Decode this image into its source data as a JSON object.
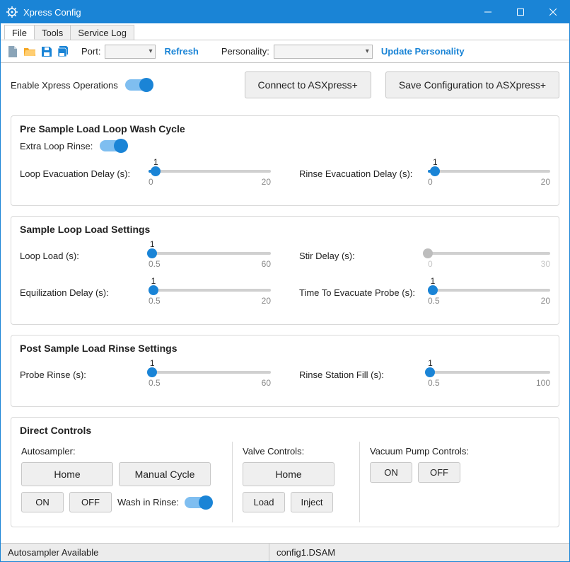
{
  "window": {
    "title": "Xpress Config"
  },
  "menu": {
    "file": "File",
    "tools": "Tools",
    "service_log": "Service Log"
  },
  "toolbar": {
    "port_label": "Port:",
    "refresh": "Refresh",
    "personality_label": "Personality:",
    "update_personality": "Update Personality"
  },
  "top": {
    "enable_label": "Enable Xpress Operations",
    "connect_btn": "Connect to ASXpress+",
    "save_btn": "Save Configuration to ASXpress+"
  },
  "sections": {
    "pre_wash": {
      "title": "Pre Sample Load Loop Wash Cycle",
      "extra_rinse_label": "Extra Loop Rinse:",
      "loop_evac": {
        "label": "Loop Evacuation Delay (s):",
        "value": "1",
        "min": "0",
        "max": "20"
      },
      "rinse_evac": {
        "label": "Rinse Evacuation Delay (s):",
        "value": "1",
        "min": "0",
        "max": "20"
      }
    },
    "loop_load": {
      "title": "Sample Loop Load Settings",
      "loop_load": {
        "label": "Loop Load (s):",
        "value": "1",
        "min": "0.5",
        "max": "60"
      },
      "stir_delay": {
        "label": "Stir Delay (s):",
        "value": "",
        "min": "0",
        "max": "30"
      },
      "equil": {
        "label": "Equilization Delay (s):",
        "value": "1",
        "min": "0.5",
        "max": "20"
      },
      "evac_probe": {
        "label": "Time To Evacuate Probe (s):",
        "value": "1",
        "min": "0.5",
        "max": "20"
      }
    },
    "post_rinse": {
      "title": "Post Sample Load Rinse Settings",
      "probe_rinse": {
        "label": "Probe Rinse (s):",
        "value": "1",
        "min": "0.5",
        "max": "60"
      },
      "station_fill": {
        "label": "Rinse Station Fill (s):",
        "value": "1",
        "min": "0.5",
        "max": "100"
      }
    },
    "direct": {
      "title": "Direct Controls",
      "autosampler_label": "Autosampler:",
      "valve_label": "Valve Controls:",
      "vacuum_label": "Vacuum Pump Controls:",
      "home": "Home",
      "manual_cycle": "Manual Cycle",
      "on": "ON",
      "off": "OFF",
      "wash_in_rinse": "Wash in Rinse:",
      "load": "Load",
      "inject": "Inject"
    }
  },
  "status": {
    "left": "Autosampler Available",
    "right": "config1.DSAM"
  }
}
